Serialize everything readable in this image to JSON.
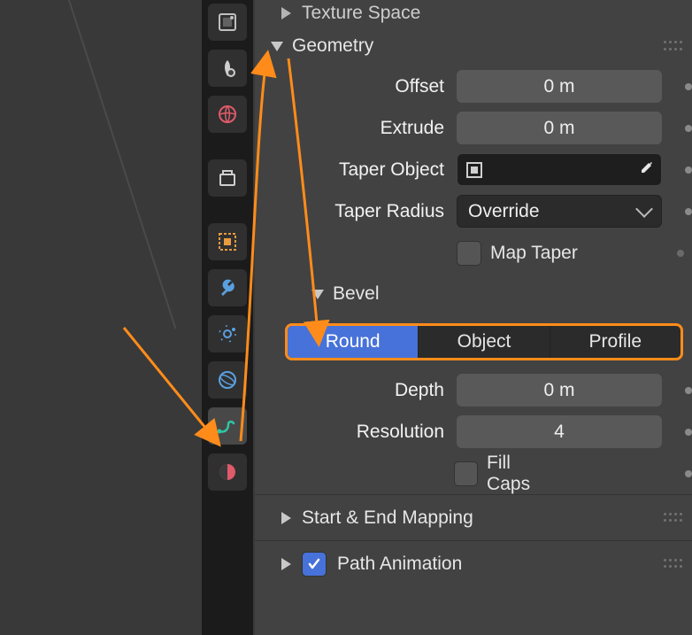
{
  "viewport": {},
  "tabs": {
    "items": [
      {
        "name": "render",
        "color": "#cfcfcf"
      },
      {
        "name": "output",
        "color": "#cfcfcf"
      },
      {
        "name": "world",
        "color": "#e05a6a"
      },
      {
        "name": "collection",
        "color": "#cfcfcf"
      },
      {
        "name": "object",
        "color": "#e89b40"
      },
      {
        "name": "modifier",
        "color": "#5aa0e0"
      },
      {
        "name": "particles",
        "color": "#5aa0e0"
      },
      {
        "name": "physics",
        "color": "#5aa0e0"
      },
      {
        "name": "curve-data",
        "color": "#2ec6a4",
        "active": true
      },
      {
        "name": "material",
        "color": "#e05a6a"
      }
    ]
  },
  "panels": {
    "texture_space_label": "Texture Space",
    "geometry": {
      "label": "Geometry",
      "offset_label": "Offset",
      "offset_value": "0 m",
      "extrude_label": "Extrude",
      "extrude_value": "0 m",
      "taper_object_label": "Taper Object",
      "taper_radius_label": "Taper Radius",
      "taper_radius_value": "Override",
      "map_taper_label": "Map Taper",
      "bevel": {
        "label": "Bevel",
        "mode_round": "Round",
        "mode_object": "Object",
        "mode_profile": "Profile",
        "depth_label": "Depth",
        "depth_value": "0 m",
        "resolution_label": "Resolution",
        "resolution_value": "4",
        "fill_caps_label": "Fill Caps"
      }
    },
    "start_end_label": "Start & End Mapping",
    "path_anim_label": "Path Animation"
  }
}
